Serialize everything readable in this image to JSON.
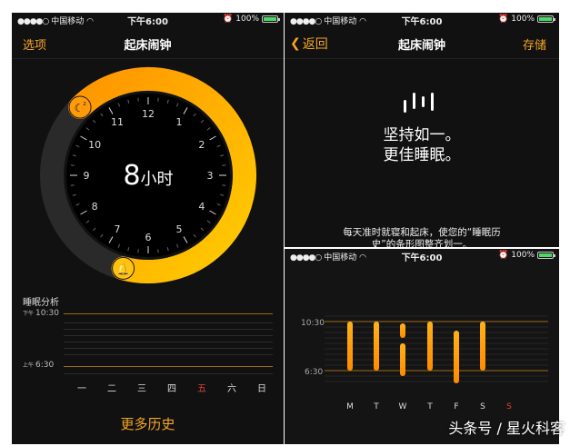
{
  "status_bar": {
    "carrier": "中国移动",
    "time": "下午6:00",
    "battery": "100%"
  },
  "left": {
    "nav_left": "选项",
    "title": "起床闹钟",
    "duration_number": "8",
    "duration_unit": "小时",
    "clock_numbers": [
      "12",
      "1",
      "2",
      "3",
      "4",
      "5",
      "6",
      "7",
      "8",
      "9",
      "10",
      "11"
    ],
    "bedtime": "下午10:30",
    "waketime": "上午6:30",
    "sleep_analysis_title": "睡眠分析",
    "chart_top_prefix": "下午",
    "chart_top_time": "10:30",
    "chart_bottom_prefix": "上午",
    "chart_bottom_time": "6:30",
    "days": [
      "一",
      "二",
      "三",
      "四",
      "五",
      "六",
      "日"
    ],
    "highlight_day_index": 4,
    "more_history": "更多历史"
  },
  "right_top": {
    "back": "返回",
    "title": "起床闹钟",
    "save": "存储",
    "slogan_line1": "坚持如一。",
    "slogan_line2": "更佳睡眠。",
    "desc_line1": "每天准时就寝和起床，使您的“睡眠历",
    "desc_line2": "史”的条形图整齐划一。"
  },
  "right_bottom": {
    "y_top": "10:30",
    "y_bottom": "6:30",
    "days": [
      "M",
      "T",
      "W",
      "T",
      "F",
      "S",
      "S"
    ],
    "highlight_day_index": 6
  },
  "colors": {
    "accent": "#f5a623",
    "ring_start": "#ff9500",
    "ring_end": "#ffcc00",
    "sunday": "#e0413a",
    "background": "#111112"
  },
  "watermark": "头条号 / 星火科客"
}
